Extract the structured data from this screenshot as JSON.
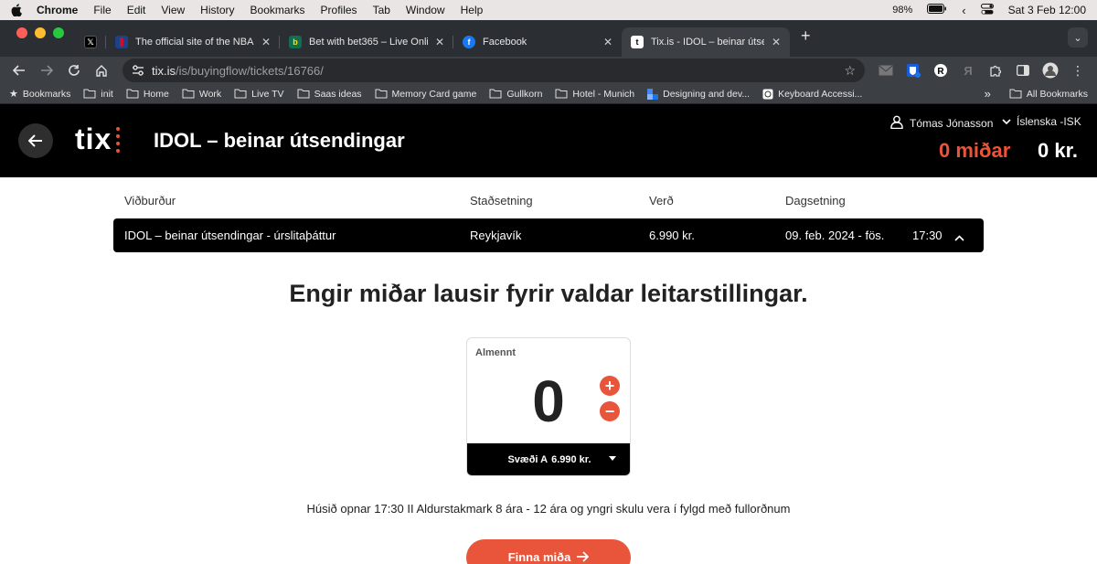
{
  "menubar": {
    "app": "Chrome",
    "items": [
      "File",
      "Edit",
      "View",
      "History",
      "Bookmarks",
      "Profiles",
      "Tab",
      "Window",
      "Help"
    ],
    "battery": "98%",
    "clock": "Sat 3 Feb  12:00"
  },
  "tabs": [
    {
      "title": "",
      "icon": "x-logo-icon"
    },
    {
      "title": "The official site of the NBA fo",
      "icon": "nba-icon"
    },
    {
      "title": "Bet with bet365 – Live Online",
      "icon": "bet365-icon"
    },
    {
      "title": "Facebook",
      "icon": "facebook-icon"
    },
    {
      "title": "Tix.is - IDOL – beinar útsendi",
      "icon": "tix-icon",
      "active": true
    }
  ],
  "omnibox": {
    "host": "tix.is",
    "path": "/is/buyingflow/tickets/16766/"
  },
  "bookmarks": {
    "items": [
      "Bookmarks",
      "init",
      "Home",
      "Work",
      "Live TV",
      "Saas ideas",
      "Memory Card game",
      "Gullkorn",
      "Hotel - Munich",
      "Designing and dev...",
      "Keyboard Accessi..."
    ],
    "all": "All Bookmarks"
  },
  "header": {
    "logo": "tix",
    "title": "IDOL – beinar útsendingar",
    "user": "Tómas Jónasson",
    "language": "Íslenska -ISK",
    "tickets": "0 miðar",
    "total": "0 kr."
  },
  "table": {
    "headers": {
      "event": "Viðburður",
      "location": "Staðsetning",
      "price": "Verð",
      "date": "Dagsetning"
    },
    "row": {
      "event": "IDOL – beinar útsendingar - úrslitaþáttur",
      "location": "Reykjavík",
      "price": "6.990 kr.",
      "date": "09. feb. 2024 - fös.",
      "time": "17:30"
    }
  },
  "message": "Engir miðar lausir fyrir valdar leitarstillingar.",
  "ticket": {
    "category": "Almennt",
    "quantity": "0",
    "plus": "+",
    "minus": "−",
    "zone": "Svæði A",
    "zone_price": "6.990 kr."
  },
  "info": "Húsið opnar 17:30 II Aldurstakmark 8 ára - 12 ára og yngri skulu vera í fylgd með fullorðnum",
  "cta": "Finna miða",
  "colors": {
    "accent": "#e8553b",
    "header_bg": "#000000"
  }
}
